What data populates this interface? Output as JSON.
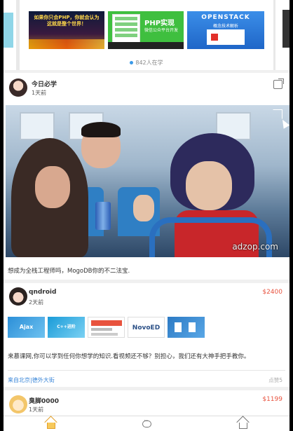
{
  "carousel": {
    "banners": [
      {
        "headline": "如果你只会PHP，你就会认为这就是整个世界！",
        "theme": "night-city"
      },
      {
        "headline": "PHP实现",
        "sub": "微信公众平台开发",
        "theme": "green"
      },
      {
        "headline": "OPENSTACK",
        "sub": "概念技术解析",
        "theme": "blue"
      }
    ],
    "online_count": "842人在学"
  },
  "posts": [
    {
      "user": "今日必学",
      "time": "1天前",
      "video_watermark": "adzop.com",
      "caption": "想成为全栈工程师吗，MogoDB你的不二法宝."
    },
    {
      "user": "qndroid",
      "time": "2天前",
      "price": "$2400",
      "images": [
        {
          "label": "Ajax"
        },
        {
          "label": "C++进阶"
        },
        {
          "label": ""
        },
        {
          "label": "NovoED"
        },
        {
          "label": ""
        }
      ],
      "description": "来慕课网,你可以学到任何你想学的知识.看视频还不够？别担心，我们还有大神手把手教你。",
      "location": "来自北京|德外大街",
      "likes": "点赞5"
    },
    {
      "user": "臭脚0000",
      "time": "1天前",
      "price": "$1199"
    }
  ],
  "tabbar": {
    "icons": [
      "home-icon",
      "message-icon",
      "home-outline-icon"
    ]
  },
  "colors": {
    "price": "#e8523e",
    "link": "#3a86d8",
    "active_tab": "#e2a12e"
  }
}
